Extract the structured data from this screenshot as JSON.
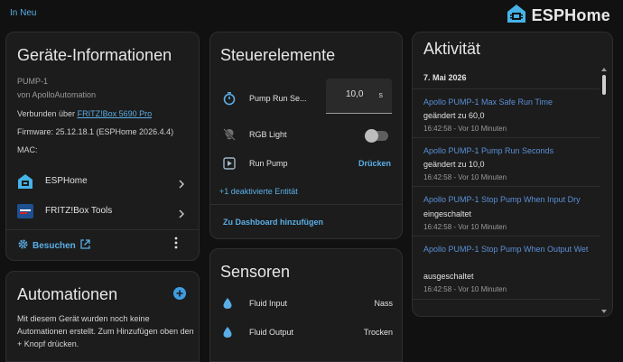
{
  "topbar": {
    "back_label": "In Neu",
    "brand": "ESPHome"
  },
  "device_info": {
    "title": "Geräte-Informationen",
    "name": "PUMP-1",
    "manufacturer": "von ApolloAutomation",
    "connected_prefix": "Verbunden über",
    "connected_link": "FRITZ!Box 5690 Pro",
    "firmware": "Firmware: 25.12.18.1 (ESPHome 2026.4.4)",
    "mac_label": "MAC:",
    "nav": [
      {
        "label": "ESPHome"
      },
      {
        "label": "FRITZ!Box Tools"
      }
    ],
    "visit_label": "Besuchen"
  },
  "automations": {
    "title": "Automationen",
    "text": "Mit diesem Gerät wurden noch keine Automationen erstellt. Zum Hinzufügen oben den + Knopf drücken."
  },
  "controls": {
    "title": "Steuerelemente",
    "pump_run_label": "Pump Run Se...",
    "pump_run_value": "10,0",
    "pump_run_unit": "s",
    "rgb_label": "RGB Light",
    "rgb_on": false,
    "run_pump_label": "Run Pump",
    "run_pump_button": "Drücken",
    "hidden_entities": "+1 deaktivierte Entität",
    "dashboard_button": "Zu Dashboard hinzufügen"
  },
  "sensors": {
    "title": "Sensoren",
    "items": [
      {
        "label": "Fluid Input",
        "value": "Nass"
      },
      {
        "label": "Fluid Output",
        "value": "Trocken"
      }
    ]
  },
  "activity": {
    "title": "Aktivität",
    "date": "7. Mai 2026",
    "items": [
      {
        "name": "Apollo PUMP-1 Max Safe Run Time",
        "state": "geändert zu 60,0",
        "time": "16:42:58 - Vor 10 Minuten"
      },
      {
        "name": "Apollo PUMP-1 Pump Run Seconds",
        "state": "geändert zu 10,0",
        "time": "16:42:58 - Vor 10 Minuten"
      },
      {
        "name": "Apollo PUMP-1 Stop Pump When Input Dry",
        "state": "eingeschaltet",
        "time": "16:42:58 - Vor 10 Minuten"
      },
      {
        "name": "Apollo PUMP-1 Stop Pump When Output Wet",
        "state": "ausgeschaltet",
        "time": "16:42:58 - Vor 10 Minuten"
      }
    ]
  },
  "colors": {
    "accent": "#5aaee6",
    "card": "#1c1c1c",
    "background": "#111111",
    "history_link": "#5a8fd6"
  },
  "icons": [
    "esphome-logo-icon",
    "timer-icon",
    "lightbulb-off-icon",
    "run-pump-icon",
    "water-drop-icon",
    "chevron-right-icon",
    "open-in-new-icon",
    "cog-icon",
    "dots-vertical-icon",
    "plus-circle-icon"
  ]
}
